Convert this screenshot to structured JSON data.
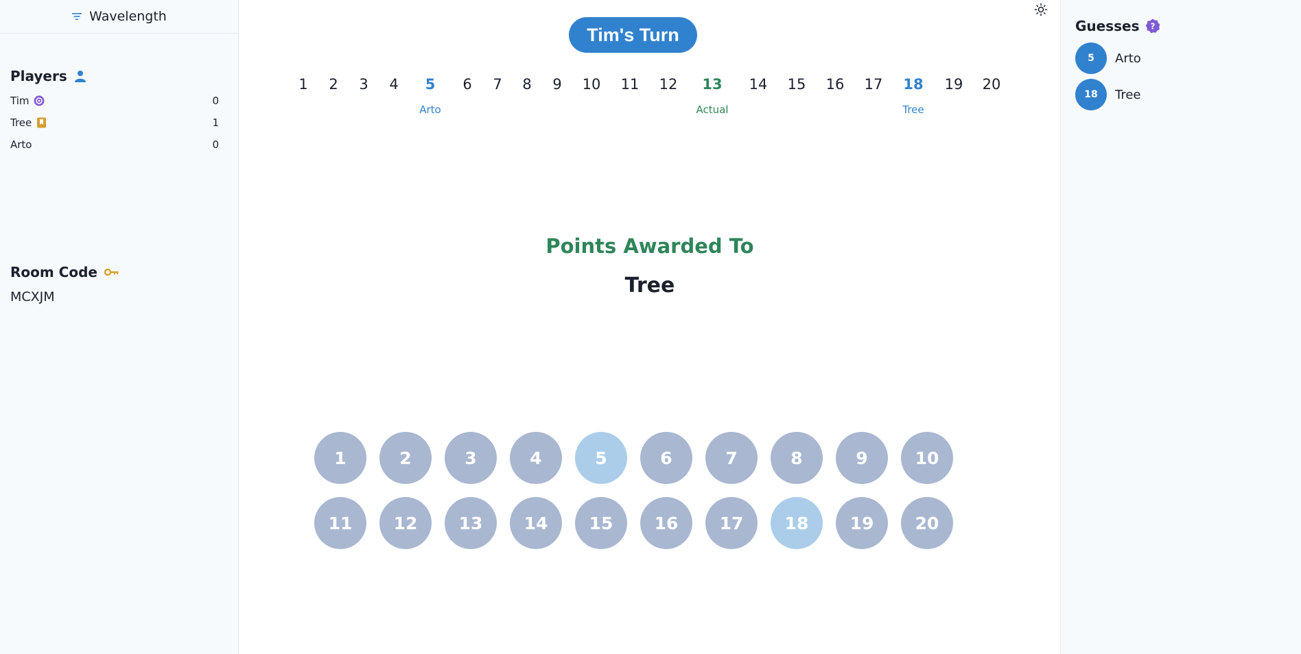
{
  "app": {
    "title": "Wavelength"
  },
  "players": {
    "heading": "Players",
    "list": [
      {
        "name": "Tim",
        "score": "0",
        "icon": "target-icon",
        "icon_color": "#805ad5"
      },
      {
        "name": "Tree",
        "score": "1",
        "icon": "bookmark-icon",
        "icon_color": "#d69e2e"
      },
      {
        "name": "Arto",
        "score": "0",
        "icon": "",
        "icon_color": ""
      }
    ]
  },
  "room": {
    "heading": "Room Code",
    "code": "MCXJM"
  },
  "turn": {
    "label": "Tim's Turn"
  },
  "scale": {
    "numbers": [
      "1",
      "2",
      "3",
      "4",
      "5",
      "6",
      "7",
      "8",
      "9",
      "10",
      "11",
      "12",
      "13",
      "14",
      "15",
      "16",
      "17",
      "18",
      "19",
      "20"
    ],
    "guesses": [
      {
        "value": "5",
        "player": "Arto"
      },
      {
        "value": "18",
        "player": "Tree"
      }
    ],
    "actual": {
      "value": "13",
      "label": "Actual"
    }
  },
  "result": {
    "heading": "Points Awarded To",
    "winner": "Tree"
  },
  "number_grid": {
    "values": [
      "1",
      "2",
      "3",
      "4",
      "5",
      "6",
      "7",
      "8",
      "9",
      "10",
      "11",
      "12",
      "13",
      "14",
      "15",
      "16",
      "17",
      "18",
      "19",
      "20"
    ],
    "selected": [
      "5",
      "18"
    ]
  },
  "guesses_panel": {
    "heading": "Guesses",
    "items": [
      {
        "value": "5",
        "player": "Arto"
      },
      {
        "value": "18",
        "player": "Tree"
      }
    ]
  },
  "colors": {
    "accent": "#3182ce",
    "actual": "#2f855a",
    "circle": "#a9b7d1",
    "circle_selected": "#abcdea"
  }
}
